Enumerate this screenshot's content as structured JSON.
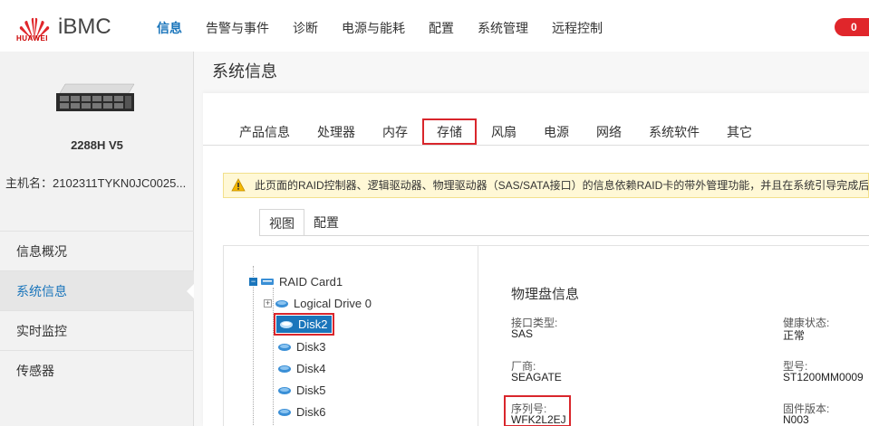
{
  "header": {
    "brand": "iBMC",
    "logo_text": "HUAWEI",
    "nav": [
      "信息",
      "告警与事件",
      "诊断",
      "电源与能耗",
      "配置",
      "系统管理",
      "远程控制"
    ],
    "alert_count": "0",
    "colors": {
      "accent": "#1a75bb",
      "alert": "#e0262b",
      "highlight": "#d9262c"
    }
  },
  "sidebar": {
    "model": "2288H V5",
    "hostname": "主机名：2102311TYKN0JC0025...",
    "items": [
      "信息概况",
      "系统信息",
      "实时监控",
      "传感器"
    ]
  },
  "main": {
    "title": "系统信息",
    "tabs": [
      "产品信息",
      "处理器",
      "内存",
      "存储",
      "风扇",
      "电源",
      "网络",
      "系统软件",
      "其它"
    ],
    "warning": "此页面的RAID控制器、逻辑驱动器、物理驱动器（SAS/SATA接口）的信息依赖RAID卡的带外管理功能，并且在系统引导完成后",
    "subtabs": [
      "视图",
      "配置"
    ]
  },
  "tree": {
    "raid_card": "RAID Card1",
    "logical_drive": "Logical Drive 0",
    "disks": [
      "Disk2",
      "Disk3",
      "Disk4",
      "Disk5",
      "Disk6"
    ]
  },
  "detail": {
    "title": "物理盘信息",
    "interface_label": "接口类型:",
    "interface_value": "SAS",
    "health_label": "健康状态:",
    "health_value": "正常",
    "vendor_label": "厂商:",
    "vendor_value": "SEAGATE",
    "model_label": "型号:",
    "model_value": "ST1200MM0009",
    "serial_label": "序列号:",
    "serial_value": "WFK2L2EJ",
    "firmware_label": "固件版本:",
    "firmware_value": "N003"
  }
}
